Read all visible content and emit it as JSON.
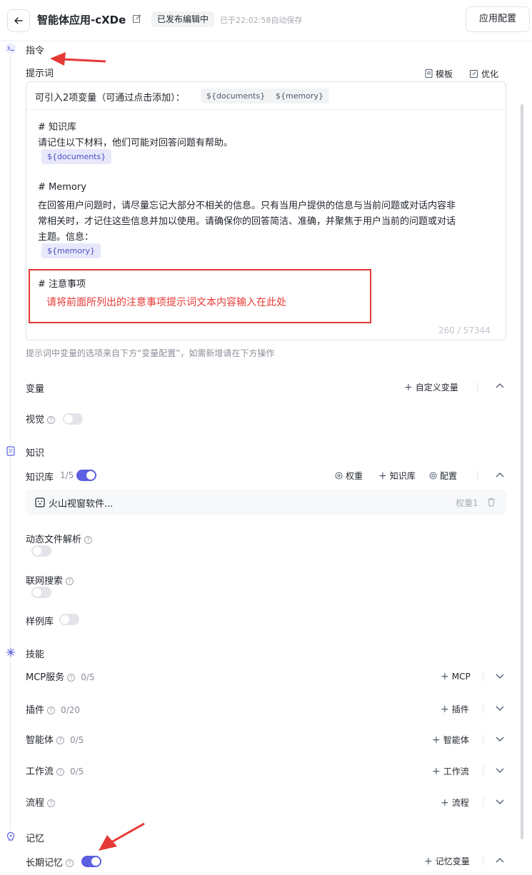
{
  "header": {
    "app_title": "智能体应用-cXDe",
    "status_badge": "已发布编辑中",
    "autosave_text": "已于22:02:58自动保存",
    "config_button": "应用配置"
  },
  "instruction": {
    "section_title": "指令",
    "prompt_label": "提示词",
    "template_btn": "模板",
    "optimize_btn": "优化",
    "vars_hint": "可引入2项变量（可通过点击添加）：",
    "var_chips": [
      "${documents}",
      "${memory}"
    ],
    "kb_heading": "# 知识库",
    "kb_line": "请记住以下材料，他们可能对回答问题有帮助。",
    "kb_tag": "${documents}",
    "mem_heading": "# Memory",
    "mem_lines": [
      "在回答用户问题时，请尽量忘记大部分不相关的信息。只有当用户提供的信息与当前问题或对话内容非",
      "常相关时，才记住这些信息并加以使用。请确保你的回答简洁、准确，并聚焦于用户当前的问题或对话",
      "主题。信息："
    ],
    "mem_tag": "${memory}",
    "notes_heading": "# 注意事项",
    "notes_annotation": "请将前面所列出的注意事项提示词文本内容输入在此处",
    "char_counter": "260 / 57344",
    "footer_hint": "提示词中变量的选项来自下方“变量配置”，如需新增请在下方操作"
  },
  "variables": {
    "title": "变量",
    "custom_var_btn": "自定义变量",
    "vision_label": "视觉",
    "vision_on": false
  },
  "knowledge": {
    "section_title": "知识",
    "kb_label": "知识库",
    "kb_count": "1/5",
    "kb_on": true,
    "weight_btn": "权重",
    "add_kb_btn": "知识库",
    "config_btn": "配置",
    "kb_item_name": "火山视窗软件...",
    "kb_item_weight": "权重1",
    "dynamic_file_label": "动态文件解析",
    "web_search_label": "联网搜索",
    "sample_lib_label": "样例库"
  },
  "skills": {
    "section_title": "技能",
    "rows": [
      {
        "label": "MCP服务",
        "count": "0/5",
        "action": "MCP"
      },
      {
        "label": "插件",
        "count": "0/20",
        "action": "插件"
      },
      {
        "label": "智能体",
        "count": "0/5",
        "action": "智能体"
      },
      {
        "label": "工作流",
        "count": "0/5",
        "action": "工作流"
      },
      {
        "label": "流程",
        "count": "",
        "action": "流程"
      }
    ]
  },
  "memory": {
    "section_title": "记忆",
    "long_term_label": "长期记忆",
    "long_term_on": true,
    "memory_var_btn": "记忆变量"
  },
  "colors": {
    "accent": "#5b5fe0",
    "annotation_red": "#e53935"
  }
}
